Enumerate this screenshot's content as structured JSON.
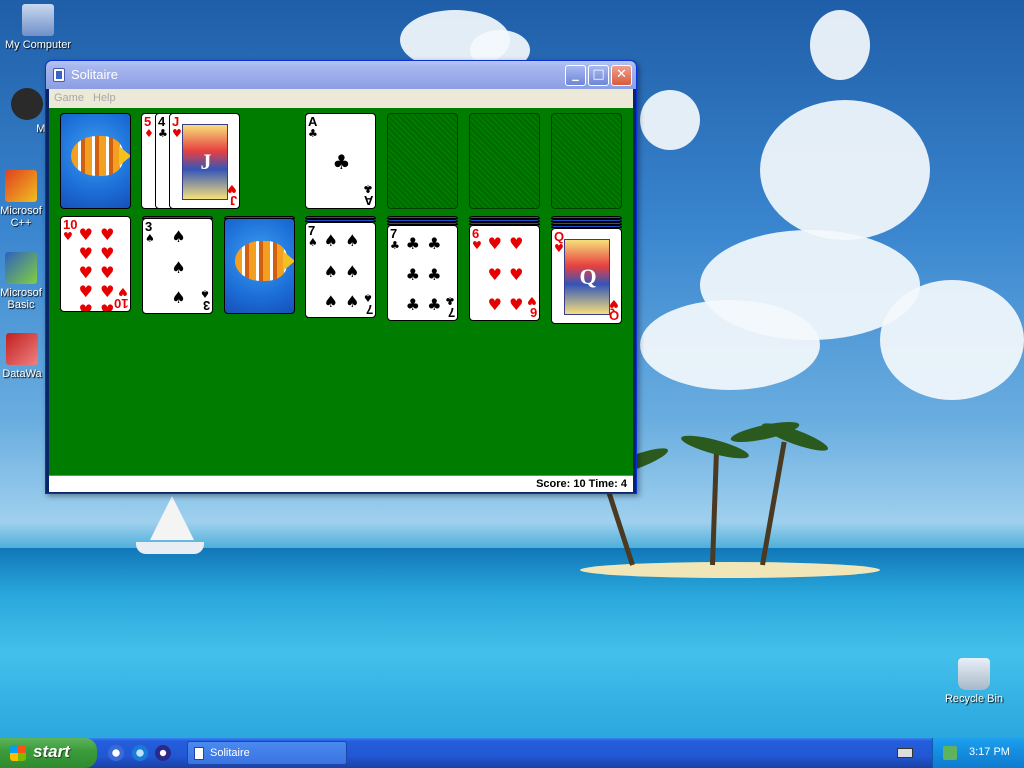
{
  "desktop": {
    "icons": [
      {
        "label": "My Computer"
      },
      {
        "label": "Myp"
      },
      {
        "label": "Microsof"
      },
      {
        "label": "C++"
      },
      {
        "label": "Microsof"
      },
      {
        "label": "Basic"
      },
      {
        "label": "DataWa"
      },
      {
        "label": "Recycle Bin"
      }
    ]
  },
  "window": {
    "title": "Solitaire",
    "buttons": {
      "minimize": "_",
      "maximize": "□",
      "close": "✕"
    },
    "menu": [
      "Game",
      "Help"
    ],
    "status": "Score: 10 Time: 4"
  },
  "game": {
    "waste": {
      "visible": [
        {
          "rank": "5",
          "suit": "♦",
          "color": "red"
        },
        {
          "rank": "4",
          "suit": "♣",
          "color": "black"
        },
        {
          "rank": "J",
          "suit": "♥",
          "color": "red"
        }
      ]
    },
    "foundations": [
      {
        "rank": "A",
        "suit": "♣",
        "color": "black"
      },
      null,
      null,
      null
    ],
    "tableau": [
      {
        "top": {
          "rank": "10",
          "suit": "♥",
          "color": "red"
        }
      },
      {
        "top": {
          "rank": "3",
          "suit": "♠",
          "color": "black"
        }
      },
      {
        "top": null
      },
      {
        "top": {
          "rank": "7",
          "suit": "♠",
          "color": "black"
        }
      },
      {
        "top": {
          "rank": "7",
          "suit": "♣",
          "color": "black"
        }
      },
      {
        "top": {
          "rank": "6",
          "suit": "♥",
          "color": "red"
        }
      },
      {
        "top": {
          "rank": "Q",
          "suit": "♥",
          "color": "red"
        }
      }
    ]
  },
  "taskbar": {
    "start_label": "start",
    "task_label": "Solitaire",
    "clock": "3:17 PM"
  },
  "colors": {
    "felt": "#007d00",
    "titlebar": "#a6b6ee",
    "taskbar": "#245edb",
    "start": "#3c9d3c",
    "card_red": "#e60000"
  }
}
